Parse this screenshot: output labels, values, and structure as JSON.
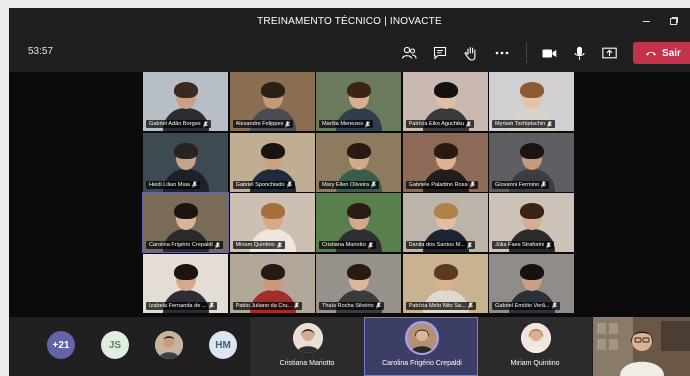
{
  "window": {
    "title": "TREINAMENTO TÉCNICO | INOVACTE"
  },
  "toolbar": {
    "timer": "53:57",
    "leave_label": "Sair",
    "icons": [
      "participants-icon",
      "chat-icon",
      "raise-hand-icon",
      "more-icon",
      "camera-icon",
      "mic-icon",
      "share-icon"
    ],
    "leave_color": "#c4314b"
  },
  "grid": {
    "tiles": [
      {
        "name": "Gabriel Adão Borges",
        "bg": "#b8bec6",
        "skin": "#c9a087",
        "shirt": "#2a2d33",
        "hair": "#3a2a20"
      },
      {
        "name": "Alexandre Felippes",
        "bg": "#8a6e52",
        "skin": "#c49a7a",
        "shirt": "#4b4b52",
        "hair": "#2b1f17"
      },
      {
        "name": "Marília Menezes",
        "bg": "#6b7a5c",
        "skin": "#d9ad8f",
        "shirt": "#2f3d4d",
        "hair": "#3b2415"
      },
      {
        "name": "Patrícia Eiko Aguchiku",
        "bg": "#c9b9b0",
        "skin": "#e0bfa8",
        "shirt": "#3a3a3a",
        "hair": "#15110f"
      },
      {
        "name": "Myriam Tschiptschin",
        "bg": "#d2cfd2",
        "skin": "#e7c3a6",
        "shirt": "#d9d4c9",
        "hair": "#8c5a34"
      },
      {
        "name": "Heidi Lilian Maia",
        "bg": "#3d4a52",
        "skin": "#c7a38a",
        "shirt": "#1c2227",
        "hair": "#2a2420"
      },
      {
        "name": "Gabriel Sponchiado",
        "bg": "#bfae94",
        "skin": "#caa27f",
        "shirt": "#1f2a3a",
        "hair": "#1a1410"
      },
      {
        "name": "Mary Ellen Oliveira",
        "bg": "#8d7b60",
        "skin": "#d3aa8b",
        "shirt": "#3a5d4a",
        "hair": "#2c1a12"
      },
      {
        "name": "Gabriele Paladino Rosa",
        "bg": "#8c6a57",
        "skin": "#dcb196",
        "shirt": "#221c1a",
        "hair": "#2b1810"
      },
      {
        "name": "Giovanni Fermino",
        "bg": "#5d5f63",
        "skin": "#c59a7b",
        "shirt": "#3a3d42",
        "hair": "#1b1512"
      },
      {
        "name": "Carolina Frigério Crepaldi",
        "bg": "#7a6a58",
        "skin": "#d8b39a",
        "shirt": "#2a2a2a",
        "hair": "#1c140f"
      },
      {
        "name": "Miriam Quintino",
        "bg": "#cdbfb1",
        "skin": "#d9a98a",
        "shirt": "#f0e6dd",
        "hair": "#a4703c"
      },
      {
        "name": "Cristiana Mariotto",
        "bg": "#5a7f4e",
        "skin": "#d2a98c",
        "shirt": "#2f2f33",
        "hair": "#2a1c14"
      },
      {
        "name": "Danila dos Santos M...",
        "bg": "#bcb4a8",
        "skin": "#e2bea3",
        "shirt": "#1e2430",
        "hair": "#b0824a"
      },
      {
        "name": "Júlia Faes Straforini",
        "bg": "#ccc2b7",
        "skin": "#d9ae90",
        "shirt": "#2b2b2b",
        "hair": "#3a2418"
      },
      {
        "name": "Izabela Fernanda de ...",
        "bg": "#e4ddd5",
        "skin": "#d6a98a",
        "shirt": "#2d2d33",
        "hair": "#1b1411"
      },
      {
        "name": "Pablo Juliano da Cru...",
        "bg": "#b3a79a",
        "skin": "#c9997a",
        "shirt": "#a12d2d",
        "hair": "#241a14"
      },
      {
        "name": "Thaís Rocha Silvério",
        "bg": "#97928c",
        "skin": "#dcb69d",
        "shirt": "#3b3b3b",
        "hair": "#2a1a12"
      },
      {
        "name": "Patrícia Melo Nito Sa...",
        "bg": "#c9b28f",
        "skin": "#dcb193",
        "shirt": "#e0d8cf",
        "hair": "#5a3a22"
      },
      {
        "name": "Gabriel Emídio Verã...",
        "bg": "#8f8c89",
        "skin": "#c9a083",
        "shirt": "#2a3138",
        "hair": "#17120f"
      }
    ],
    "active_index": 10
  },
  "bottom_bar": {
    "overflow_count": "+21",
    "avatars": [
      {
        "initials": "JS",
        "bg": "#dfeee1",
        "fg": "#5e7f62"
      },
      {
        "initials": "HM",
        "bg": "#dbe6f0",
        "fg": "#3f5f80"
      }
    ],
    "cards": [
      {
        "name": "Cristiana Mariotto"
      },
      {
        "name": "Carolina Frigério Crepaldi"
      },
      {
        "name": "Miriam Quintino"
      }
    ]
  }
}
